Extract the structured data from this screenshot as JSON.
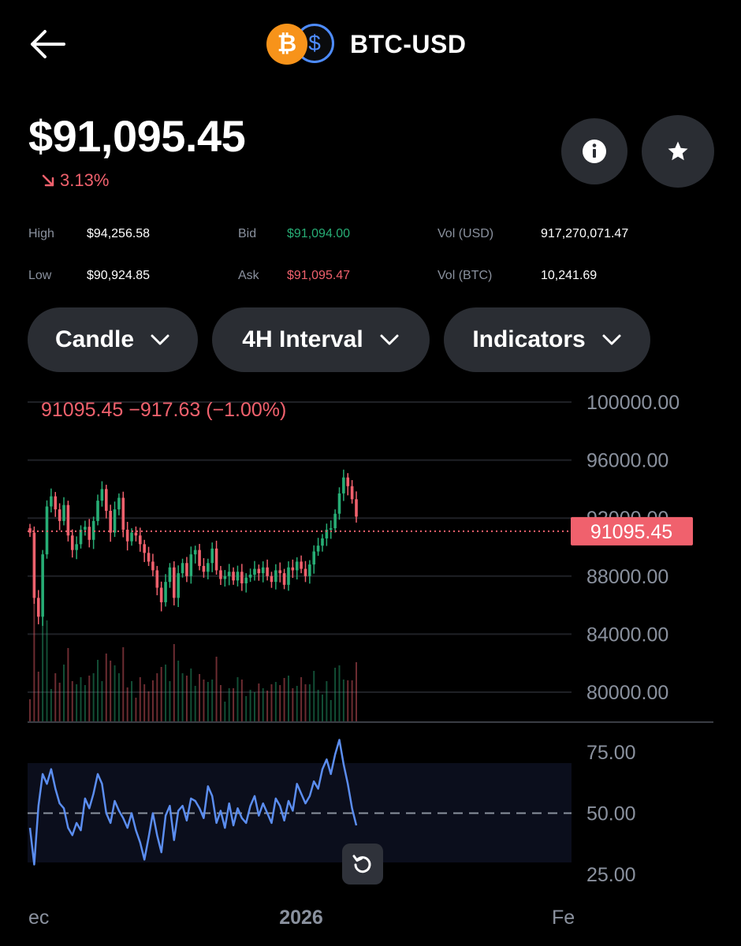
{
  "header": {
    "pair": "BTC-USD",
    "back_icon": "arrow-left-icon",
    "coin_icons": [
      "bitcoin-icon",
      "usd-coin-icon"
    ]
  },
  "price": {
    "value": "$91,095.45",
    "change": "3.13%",
    "change_icon": "arrow-down-right-icon"
  },
  "actions": {
    "info_icon": "info-icon",
    "favorite_icon": "star-icon"
  },
  "stats": {
    "high_label": "High",
    "high_value": "$94,256.58",
    "low_label": "Low",
    "low_value": "$90,924.85",
    "bid_label": "Bid",
    "bid_value": "$91,094.00",
    "ask_label": "Ask",
    "ask_value": "$91,095.47",
    "vol_usd_label": "Vol (USD)",
    "vol_usd_value": "917,270,071.47",
    "vol_btc_label": "Vol (BTC)",
    "vol_btc_value": "10,241.69"
  },
  "controls": {
    "chart_type": "Candle",
    "interval": "4H Interval",
    "indicators": "Indicators"
  },
  "colors": {
    "up": "#27ad75",
    "down": "#f0616d",
    "rsi": "#5b8def",
    "background": "#000000"
  },
  "chart_data": {
    "type": "candlestick",
    "legend": "91095.45  −917.63 (−1.00%)",
    "last_price_label": "91095.45",
    "last_price": 91095.45,
    "price_axis_ticks": [
      "100000.00",
      "96000.00",
      "92000.00",
      "88000.00",
      "84000.00",
      "80000.00"
    ],
    "price_ylim": [
      80000,
      100000
    ],
    "rsi_axis_ticks": [
      "75.00",
      "50.00",
      "25.00"
    ],
    "rsi_ylim": [
      25,
      75
    ],
    "x_ticks": [
      "ec",
      "2026",
      "Fe"
    ],
    "close_series": [
      91000,
      86500,
      85200,
      89500,
      92800,
      93500,
      92600,
      91800,
      92900,
      90800,
      89800,
      90200,
      91200,
      91400,
      90500,
      91800,
      93200,
      94000,
      92500,
      91000,
      92600,
      93400,
      91200,
      90400,
      91000,
      90800,
      90200,
      89600,
      89000,
      88400,
      87200,
      86200,
      87600,
      88600,
      86500,
      88200,
      88900,
      88000,
      89500,
      89800,
      88700,
      88300,
      88900,
      89900,
      88400,
      87800,
      88000,
      88300,
      87700,
      88300,
      87500,
      87900,
      88100,
      88500,
      88200,
      88600,
      88000,
      87600,
      88400,
      88200,
      87400,
      88600,
      88400,
      89000,
      88500,
      88000,
      88800,
      89700,
      90100,
      90600,
      91200,
      91300,
      92300,
      93700,
      94800,
      94200,
      93300,
      92100
    ],
    "rsi_series": [
      44,
      29,
      53,
      66,
      62,
      68,
      60,
      54,
      52,
      44,
      41,
      46,
      43,
      56,
      52,
      58,
      66,
      62,
      50,
      46,
      55,
      51,
      48,
      44,
      50,
      43,
      38,
      31,
      40,
      50,
      41,
      34,
      49,
      53,
      39,
      51,
      53,
      47,
      56,
      55,
      52,
      48,
      61,
      57,
      46,
      51,
      44,
      54,
      45,
      52,
      48,
      46,
      53,
      57,
      49,
      54,
      50,
      46,
      56,
      53,
      47,
      55,
      51,
      62,
      58,
      54,
      57,
      63,
      60,
      68,
      72,
      66,
      74,
      80,
      70,
      62,
      52,
      45
    ]
  }
}
